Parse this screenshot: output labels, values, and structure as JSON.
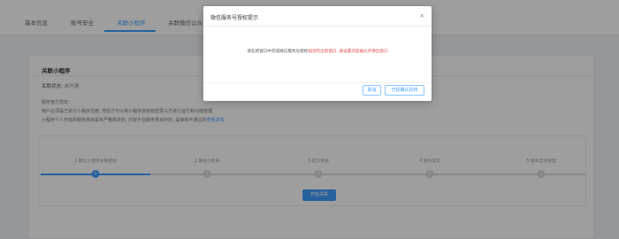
{
  "tabs": [
    "基本信息",
    "账号安全",
    "关联小程序",
    "关联微信公众号"
  ],
  "active_tab_index": 2,
  "panel": {
    "title": "关联小程序",
    "status_label": "关联状态:",
    "status_value": "未开通",
    "desc_lines": [
      "服务官方规定:",
      "用户必须是已进行小程序注册, 然后才可以将小程序授权给智慧三方进行运行和功能管理",
      "小程序个人开放的服务类目是有严格规定的, 内容不在服务类目中的, 是审核不通过的"
    ],
    "desc_link": "查看详情"
  },
  "steps": {
    "labels": [
      "1.微信小程序关联授权",
      "2.体验小程序",
      "3.提交审核",
      "4.发布成功",
      "5.版本自动管理"
    ],
    "numbers": [
      "1",
      "2",
      "3",
      "4",
      "5"
    ],
    "current": 1,
    "start_button": "开始关联"
  },
  "dialog": {
    "title": "微信服务号授权提示",
    "close_glyph": "×",
    "body_prefix": "请在新窗口中完成微信服务号授权",
    "body_warning": "如没有出新窗口, 请设置浏览器允许弹出窗口",
    "cancel_label": "取消",
    "confirm_label": "已经确认授权"
  },
  "colors": {
    "accent": "#409eff",
    "warning": "#e34848"
  }
}
